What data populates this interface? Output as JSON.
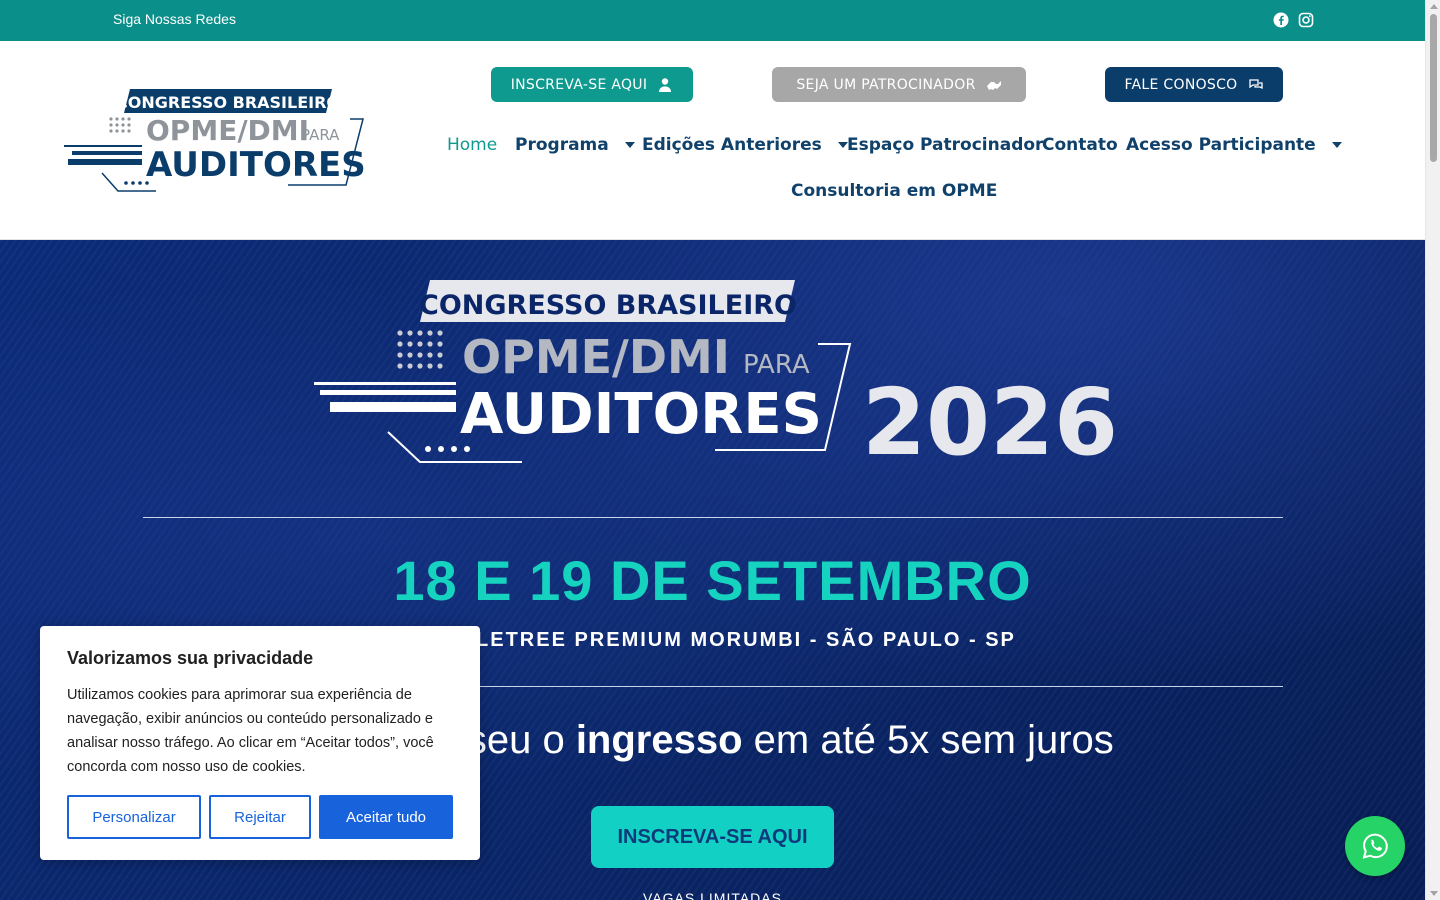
{
  "topbar": {
    "follow_label": "Siga Nossas Redes",
    "social_icons": [
      "facebook-icon",
      "instagram-icon"
    ]
  },
  "logo": {
    "line1": "CONGRESSO BRASILEIRO",
    "line2": "OPME/DMI",
    "line2_small": "PARA",
    "line3": "AUDITORES"
  },
  "header_buttons": {
    "inscreva": "INSCREVA-SE AQUI",
    "patrocinador": "SEJA UM PATROCINADOR",
    "fale": "FALE CONOSCO"
  },
  "nav": {
    "home": "Home",
    "programa": "Programa",
    "edicoes": "Edições Anteriores",
    "espaco": "Espaço Patrocinador",
    "contato": "Contato",
    "acesso": "Acesso Participante",
    "consultoria": "Consultoria em OPME"
  },
  "hero": {
    "logo_line1": "CONGRESSO BRASILEIRO",
    "logo_line2": "OPME/DMI",
    "logo_line2_small": "PARA",
    "logo_line3": "AUDITORES",
    "year": "2026",
    "date": "18 E 19 DE SETEMBRO",
    "venue": "DOUBLETREE PREMIUM MORUMBI - SÃO PAULO - SP",
    "installment_pre": "Garanta seu o ",
    "installment_bold": "ingresso",
    "installment_post": " em até 5x sem juros",
    "cta": "INSCREVA-SE AQUI",
    "limited": "VAGAS LIMITADAS"
  },
  "cookie": {
    "title": "Valorizamos sua privacidade",
    "text": "Utilizamos cookies para aprimorar sua experiência de navegação, exibir anúncios ou conteúdo personalizado e analisar nosso tráfego. Ao clicar em “Aceitar todos”, você concorda com nosso uso de cookies.",
    "customize": "Personalizar",
    "reject": "Rejeitar",
    "accept": "Aceitar tudo"
  },
  "colors": {
    "teal": "#0b8f8a",
    "navy": "#10416b",
    "hero_bg": "#0a2669",
    "accent_cyan": "#16d3c0",
    "cookie_blue": "#1863dc",
    "whatsapp": "#25d366"
  }
}
